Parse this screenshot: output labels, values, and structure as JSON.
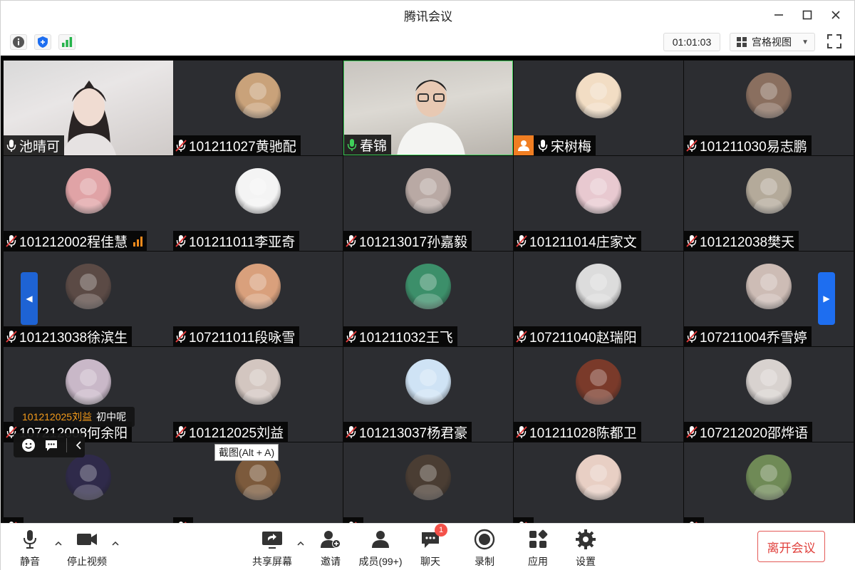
{
  "window": {
    "title": "腾讯会议"
  },
  "toolbar": {
    "timer": "01:01:03",
    "view_label": "宫格视图"
  },
  "participants": [
    {
      "name": "池晴可",
      "mic": "on",
      "kind": "video-a"
    },
    {
      "name": "101211027黄驰配",
      "mic": "muted",
      "kind": "avatar",
      "avatar_color": "#c9a27a"
    },
    {
      "name": "春锦",
      "mic": "active",
      "kind": "video-b"
    },
    {
      "name": "宋树梅",
      "mic": "on",
      "kind": "avatar",
      "host": true,
      "avatar_color": "#f2ddc4"
    },
    {
      "name": "101211030易志鹏",
      "mic": "muted",
      "kind": "avatar",
      "avatar_color": "#8a6f5f"
    },
    {
      "name": "101212002程佳慧",
      "mic": "muted",
      "kind": "avatar",
      "signal": true,
      "avatar_color": "#e0a3a6"
    },
    {
      "name": "101211011李亚奇",
      "mic": "muted",
      "kind": "avatar",
      "avatar_color": "#f4f4f4"
    },
    {
      "name": "101213017孙嘉毅",
      "mic": "muted",
      "kind": "avatar",
      "avatar_color": "#b9a9a4"
    },
    {
      "name": "101211014庄家文",
      "mic": "muted",
      "kind": "avatar",
      "avatar_color": "#e8c9d0"
    },
    {
      "name": "101212038樊天",
      "mic": "muted",
      "kind": "avatar",
      "avatar_color": "#b4aa9a"
    },
    {
      "name": "101213038徐滨生",
      "mic": "muted",
      "kind": "avatar",
      "avatar_color": "#5b4a45"
    },
    {
      "name": "107211011段咏雪",
      "mic": "muted",
      "kind": "avatar",
      "avatar_color": "#d9a07c"
    },
    {
      "name": "101211032王飞",
      "mic": "muted",
      "kind": "avatar",
      "avatar_color": "#3c8f6a"
    },
    {
      "name": "107211040赵瑞阳",
      "mic": "muted",
      "kind": "avatar",
      "avatar_color": "#dcdcdc"
    },
    {
      "name": "107211004乔雪婷",
      "mic": "muted",
      "kind": "avatar",
      "avatar_color": "#cdbcb5"
    },
    {
      "name": "107212008何余阳",
      "mic": "muted",
      "kind": "avatar",
      "avatar_color": "#c9b8c8"
    },
    {
      "name": "101212025刘益",
      "mic": "muted",
      "kind": "avatar",
      "avatar_color": "#d3c6c0"
    },
    {
      "name": "101213037杨君豪",
      "mic": "muted",
      "kind": "avatar",
      "avatar_color": "#cfe3f5"
    },
    {
      "name": "101211028陈都卫",
      "mic": "muted",
      "kind": "avatar",
      "avatar_color": "#7a3a2a"
    },
    {
      "name": "107212020邵烨语",
      "mic": "muted",
      "kind": "avatar",
      "avatar_color": "#d8d2cf"
    },
    {
      "name": "",
      "mic": "muted",
      "kind": "avatar",
      "avatar_color": "#2f2a4a"
    },
    {
      "name": "",
      "mic": "muted",
      "kind": "avatar",
      "avatar_color": "#7c5a3c"
    },
    {
      "name": "",
      "mic": "muted",
      "kind": "avatar",
      "avatar_color": "#4a3d33"
    },
    {
      "name": "",
      "mic": "muted",
      "kind": "avatar",
      "avatar_color": "#e8cfc4"
    },
    {
      "name": "",
      "mic": "muted",
      "kind": "avatar",
      "avatar_color": "#6f8a56"
    }
  ],
  "chat_popup": {
    "sender": "101212025刘益",
    "message": "初中呢"
  },
  "tooltip": "截图(Alt + A)",
  "bottom": {
    "mute": "静音",
    "stop_video": "停止视频",
    "share_screen": "共享屏幕",
    "invite": "邀请",
    "members": "成员(99+)",
    "chat": "聊天",
    "chat_badge": "1",
    "record": "录制",
    "apps": "应用",
    "settings": "设置",
    "leave": "离开会议"
  },
  "colors": {
    "accent": "#1e6ef0",
    "leave": "#e0403c",
    "muted_mic": "#e03a3a",
    "active_mic": "#3fd05a"
  }
}
